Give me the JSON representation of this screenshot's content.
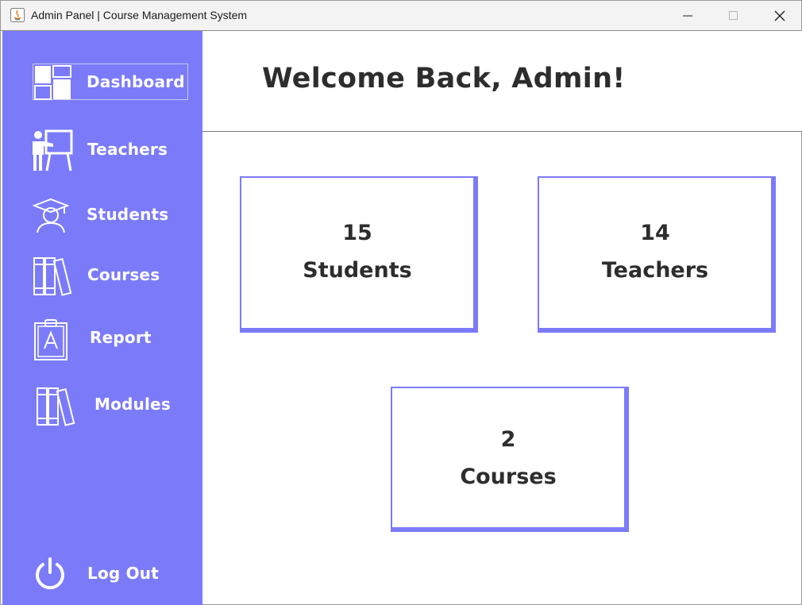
{
  "window": {
    "title": "Admin Panel | Course Management System",
    "controls": [
      "minimize",
      "maximize",
      "close"
    ]
  },
  "sidebar": {
    "background": "#7b7bfa",
    "items": [
      {
        "label": "Dashboard",
        "icon": "dashboard-icon",
        "active": true
      },
      {
        "label": "Teachers",
        "icon": "teacher-icon"
      },
      {
        "label": "Students",
        "icon": "student-icon"
      },
      {
        "label": "Courses",
        "icon": "books-icon"
      },
      {
        "label": "Report",
        "icon": "clipboard-report-icon"
      },
      {
        "label": "Modules",
        "icon": "books-icon"
      }
    ],
    "logout": {
      "label": "Log Out",
      "icon": "power-icon"
    }
  },
  "header": {
    "welcome": "Welcome Back, Admin!"
  },
  "stats": {
    "students": {
      "count": "15",
      "label": "Students"
    },
    "teachers": {
      "count": "14",
      "label": "Teachers"
    },
    "courses": {
      "count": "2",
      "label": "Courses"
    }
  },
  "colors": {
    "accent": "#7b7bfa",
    "text": "#2d2d2d"
  }
}
